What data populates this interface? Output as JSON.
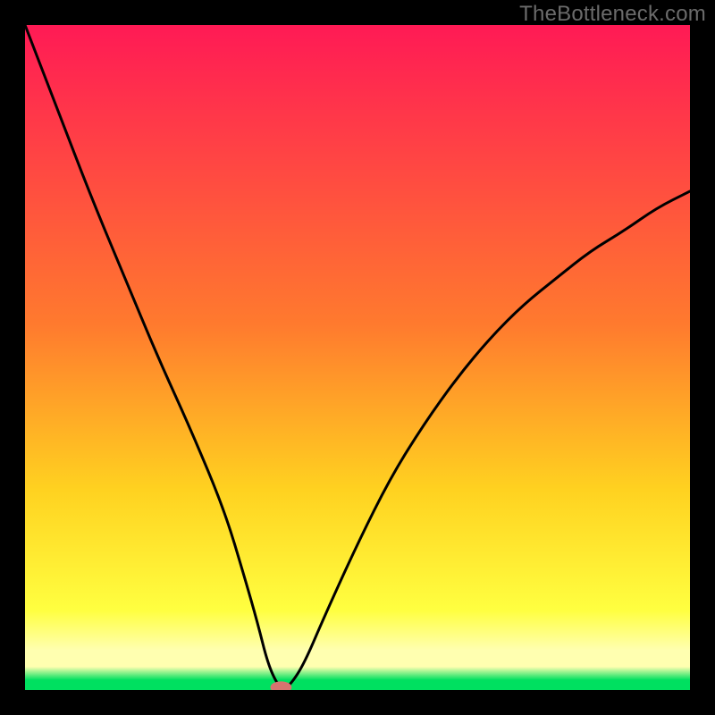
{
  "watermark": "TheBottleneck.com",
  "colors": {
    "frame": "#000000",
    "grad_top": "#ff1a55",
    "grad_mid1": "#ff7a2e",
    "grad_mid2": "#ffd220",
    "grad_yellow": "#ffff40",
    "grad_cream": "#ffffb0",
    "grad_green": "#00e060",
    "curve": "#000000",
    "marker": "#d7736f"
  },
  "chart_data": {
    "type": "line",
    "title": "",
    "xlabel": "",
    "ylabel": "",
    "xlim": [
      0,
      100
    ],
    "ylim": [
      0,
      100
    ],
    "grid": false,
    "legend": false,
    "series": [
      {
        "name": "bottleneck-curve",
        "x": [
          0,
          5,
          10,
          15,
          20,
          25,
          30,
          33,
          35,
          36.5,
          38,
          39,
          40,
          42,
          45,
          50,
          55,
          60,
          65,
          70,
          75,
          80,
          85,
          90,
          95,
          100
        ],
        "y": [
          100,
          87,
          74,
          62,
          50,
          39,
          27,
          17,
          10,
          4,
          0.7,
          0.3,
          0.9,
          4,
          11,
          22,
          32,
          40,
          47,
          53,
          58,
          62,
          66,
          69,
          72.5,
          75
        ]
      }
    ],
    "marker": {
      "x": 38.5,
      "y": 0.4,
      "rx": 1.6,
      "ry": 0.9
    },
    "gradient_stops": [
      {
        "pct": 0,
        "name": "top-red"
      },
      {
        "pct": 45,
        "name": "orange"
      },
      {
        "pct": 70,
        "name": "gold"
      },
      {
        "pct": 88,
        "name": "yellow"
      },
      {
        "pct": 94,
        "name": "cream"
      },
      {
        "pct": 100,
        "name": "green"
      }
    ]
  }
}
